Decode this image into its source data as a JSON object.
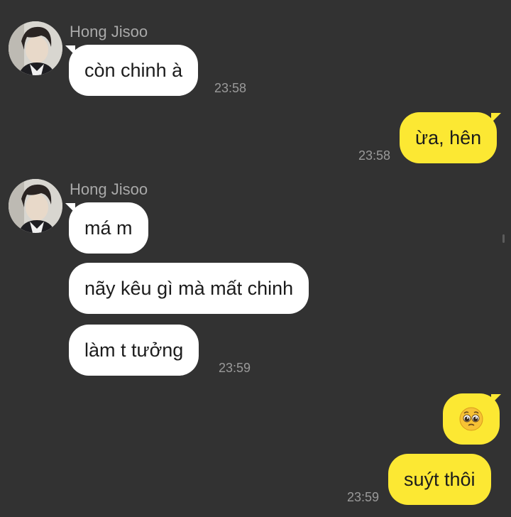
{
  "messages": [
    {
      "sender": "Hong Jisoo",
      "bubbles": [
        "còn chinh à"
      ],
      "time": "23:58"
    },
    {
      "sender": "me",
      "bubbles": [
        "ừa, hên"
      ],
      "time": "23:58"
    },
    {
      "sender": "Hong Jisoo",
      "bubbles": [
        "má m",
        "nãy kêu gì mà mất chinh",
        "làm t tưởng"
      ],
      "time": "23:59"
    },
    {
      "sender": "me",
      "bubbles": [
        "pleading-face-emoji",
        "suýt thôi"
      ],
      "time": "23:59"
    }
  ],
  "colors": {
    "background": "#323232",
    "incoming_bubble": "#ffffff",
    "outgoing_bubble": "#fce833",
    "sender_name": "#a9a9a9",
    "timestamp": "#9a9a9a"
  }
}
